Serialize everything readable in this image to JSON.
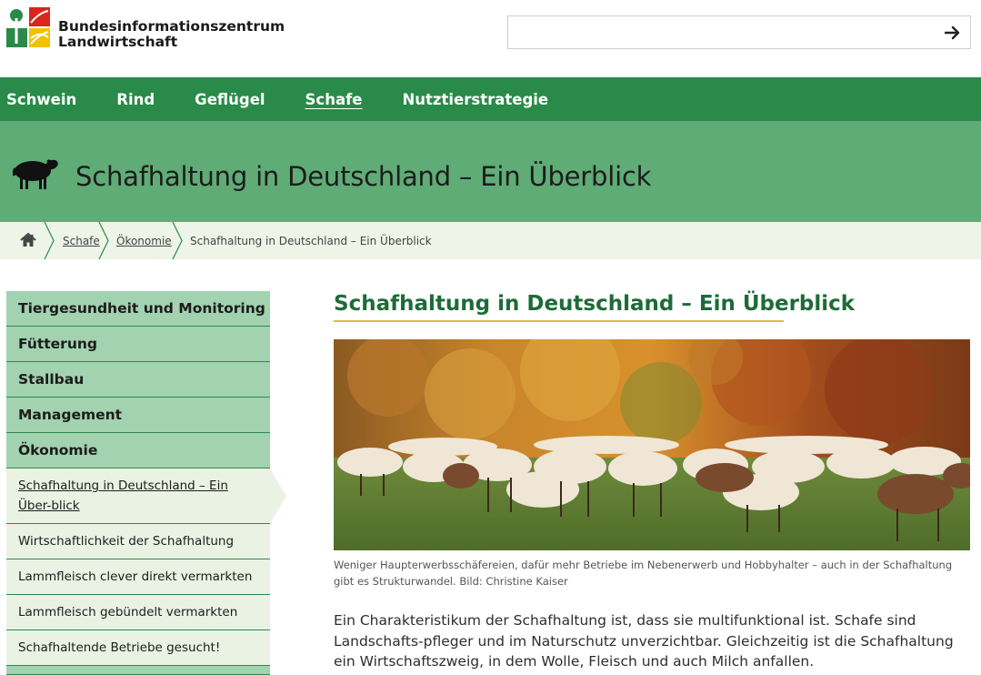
{
  "header": {
    "logo_line1": "Bundesinformationszentrum",
    "logo_line2": "Landwirtschaft",
    "search_placeholder": "",
    "search_button_icon": "arrow-right-icon"
  },
  "nav": {
    "items": [
      {
        "label": "Schwein"
      },
      {
        "label": "Rind"
      },
      {
        "label": "Geflügel"
      },
      {
        "label": "Schafe",
        "active": true
      },
      {
        "label": "Nutztierstrategie"
      }
    ]
  },
  "banner": {
    "icon": "sheep-icon",
    "title": "Schafhaltung in Deutschland – Ein Überblick"
  },
  "breadcrumb": {
    "home_icon": "home-icon",
    "items": [
      "Schafe",
      "Ökonomie"
    ],
    "current": "Schafhaltung in Deutschland – Ein Überblick"
  },
  "sidebar": {
    "main_items": [
      "Tiergesundheit und Monitoring",
      "Fütterung",
      "Stallbau",
      "Management",
      "Ökonomie"
    ],
    "active_sub": "Schafhaltung in Deutschland – Ein Über-blick",
    "sub_items": [
      "Wirtschaftlichkeit der Schafhaltung",
      "Lammfleisch clever direkt vermarkten",
      "Lammfleisch gebündelt vermarkten",
      "Schafhaltende Betriebe gesucht!"
    ]
  },
  "article": {
    "title": "Schafhaltung in Deutschland – Ein Überblick",
    "caption": "Weniger Haupterwerbsschäfereien, dafür mehr Betriebe im Nebenerwerb und Hobbyhalter – auch in der Schafhaltung gibt es Strukturwandel. Bild: Christine Kaiser",
    "lead": "Ein Charakteristikum der Schafhaltung ist, dass sie multifunktional ist. Schafe sind Landschafts-pfleger und im Naturschutz unverzichtbar. Gleichzeitig ist die Schafhaltung ein Wirtschaftszweig, in dem Wolle, Fleisch und auch Milch anfallen."
  },
  "colors": {
    "nav_green": "#2a8a49",
    "banner_green": "#5fac76",
    "sidebar_green": "#a3d2b0",
    "title_green": "#1e6b38",
    "accent_gold": "#e3b74a"
  }
}
